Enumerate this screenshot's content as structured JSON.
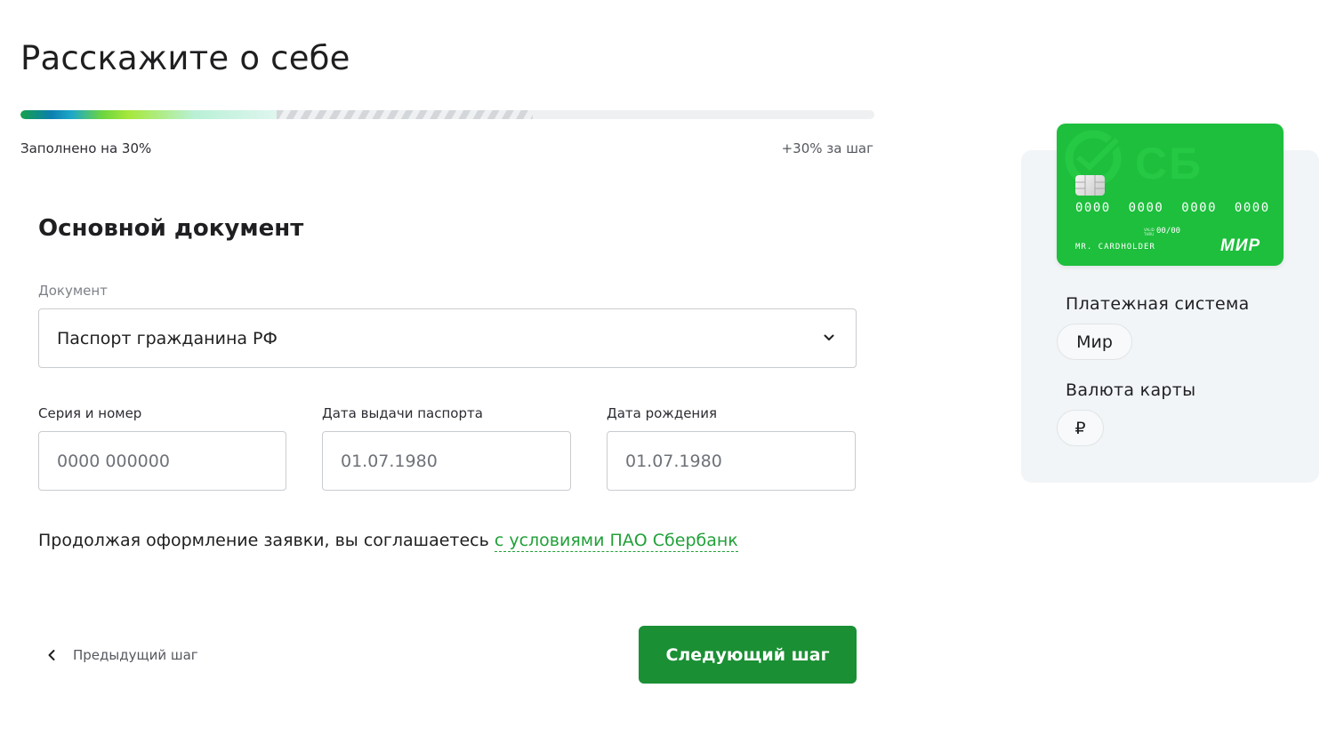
{
  "header": {
    "title": "Расскажите о себе",
    "progress": {
      "percent": 30,
      "step_percent": 30,
      "filled_label": "Заполнено на 30%",
      "step_label": "+30% за шаг"
    }
  },
  "form": {
    "section_title": "Основной документ",
    "document": {
      "label": "Документ",
      "value": "Паспорт гражданина РФ"
    },
    "series": {
      "label": "Серия и номер",
      "placeholder": "0000 000000"
    },
    "issue_date": {
      "label": "Дата выдачи паспорта",
      "placeholder": "01.07.1980"
    },
    "birth_date": {
      "label": "Дата рождения",
      "placeholder": "01.07.1980"
    },
    "consent_text": "Продолжая оформление заявки, вы соглашаетесь ",
    "consent_link": "с условиями ПАО Сбербанк",
    "prev_label": "Предыдущий шаг",
    "next_label": "Следующий шаг"
  },
  "card": {
    "logo_text": "СБ",
    "number": "0000 0000 0000 0000",
    "valid_label": "VALID THRU",
    "expiry": "00/00",
    "holder": "MR. CARDHOLDER",
    "brand": "МИР"
  },
  "side": {
    "payment_system": {
      "heading": "Платежная система",
      "value": "Мир"
    },
    "currency": {
      "heading": "Валюта карты",
      "value": "₽"
    }
  },
  "colors": {
    "accent": "#21a038",
    "button": "#1a8f34",
    "card": "#1dbf3c"
  }
}
